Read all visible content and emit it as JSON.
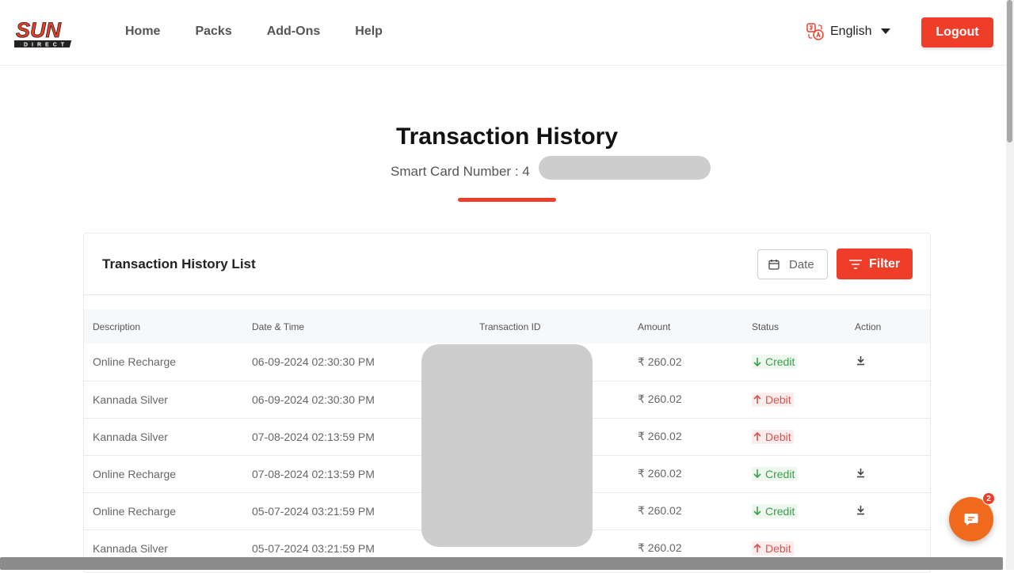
{
  "header": {
    "logo_text": "SUN",
    "logo_sub": "DIRECT",
    "nav": [
      "Home",
      "Packs",
      "Add-Ons",
      "Help"
    ],
    "language": "English",
    "logout_label": "Logout",
    "icons": {
      "language": "translate-icon",
      "dropdown": "caret-down-icon"
    }
  },
  "page": {
    "title": "Transaction History",
    "smart_card_label": "Smart Card Number : 4"
  },
  "list": {
    "title": "Transaction History List",
    "date_label": "Date",
    "filter_label": "Filter",
    "columns": [
      "Description",
      "Date & Time",
      "Transaction ID",
      "Amount",
      "Status",
      "Action"
    ],
    "rows": [
      {
        "description": "Online Recharge",
        "datetime": "06-09-2024 02:30:30 PM",
        "transaction_id": "",
        "amount": "₹ 260.02",
        "status": "Credit"
      },
      {
        "description": "Kannada Silver",
        "datetime": "06-09-2024 02:30:30 PM",
        "transaction_id": "",
        "amount": "₹ 260.02",
        "status": "Debit"
      },
      {
        "description": "Kannada Silver",
        "datetime": "07-08-2024 02:13:59 PM",
        "transaction_id": "",
        "amount": "₹ 260.02",
        "status": "Debit"
      },
      {
        "description": "Online Recharge",
        "datetime": "07-08-2024 02:13:59 PM",
        "transaction_id": "",
        "amount": "₹ 260.02",
        "status": "Credit"
      },
      {
        "description": "Online Recharge",
        "datetime": "05-07-2024 03:21:59 PM",
        "transaction_id": "",
        "amount": "₹ 260.02",
        "status": "Credit"
      },
      {
        "description": "Kannada Silver",
        "datetime": "05-07-2024 03:21:59 PM",
        "transaction_id": "",
        "amount": "₹ 260.02",
        "status": "Debit"
      }
    ]
  },
  "chat": {
    "badge_count": "2"
  },
  "colors": {
    "accent": "#ee3d29",
    "chat": "#f06a1e",
    "credit": "#3aa04a",
    "debit": "#d9534f"
  }
}
